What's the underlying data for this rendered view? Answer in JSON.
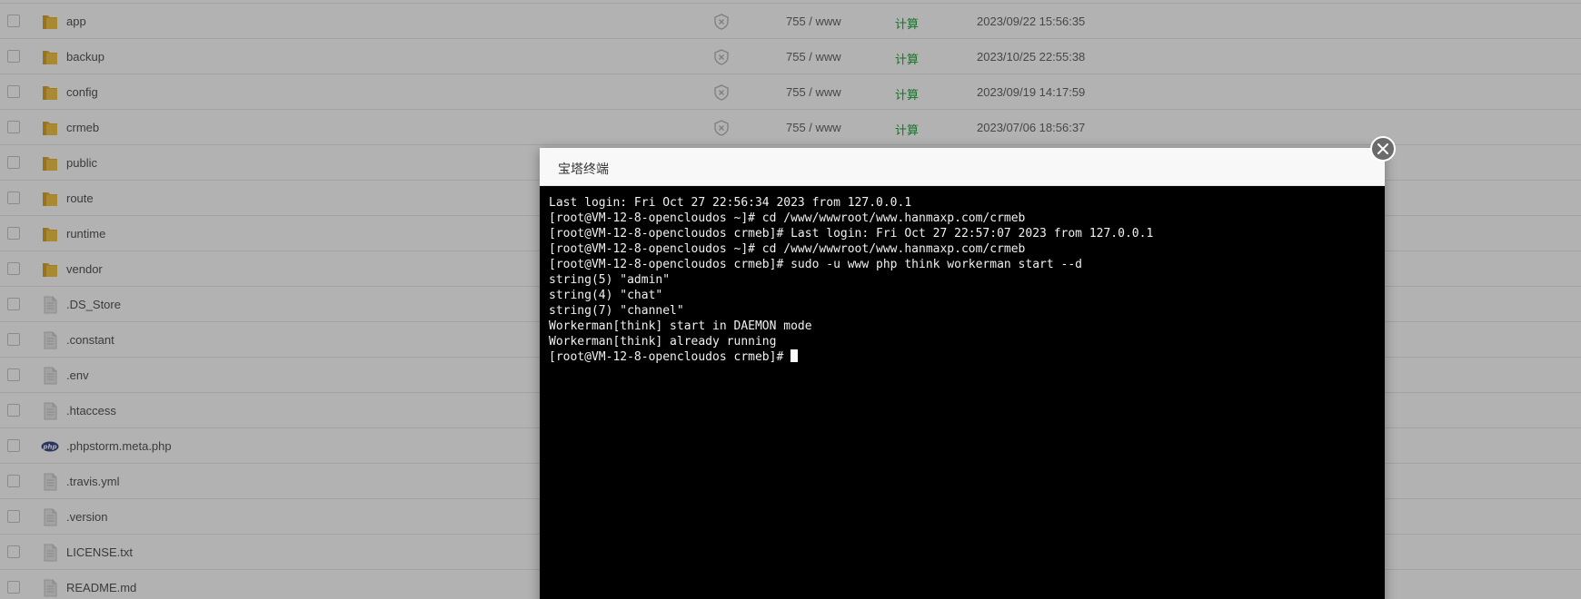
{
  "files": [
    {
      "name": "app",
      "type": "folder",
      "perm": "755 / www",
      "size_action": "计算",
      "mtime": "2023/09/22 15:56:35"
    },
    {
      "name": "backup",
      "type": "folder",
      "perm": "755 / www",
      "size_action": "计算",
      "mtime": "2023/10/25 22:55:38"
    },
    {
      "name": "config",
      "type": "folder",
      "perm": "755 / www",
      "size_action": "计算",
      "mtime": "2023/09/19 14:17:59"
    },
    {
      "name": "crmeb",
      "type": "folder",
      "perm": "755 / www",
      "size_action": "计算",
      "mtime": "2023/07/06 18:56:37"
    },
    {
      "name": "public",
      "type": "folder"
    },
    {
      "name": "route",
      "type": "folder"
    },
    {
      "name": "runtime",
      "type": "folder"
    },
    {
      "name": "vendor",
      "type": "folder"
    },
    {
      "name": ".DS_Store",
      "type": "file"
    },
    {
      "name": ".constant",
      "type": "file"
    },
    {
      "name": ".env",
      "type": "file"
    },
    {
      "name": ".htaccess",
      "type": "file"
    },
    {
      "name": ".phpstorm.meta.php",
      "type": "php"
    },
    {
      "name": ".travis.yml",
      "type": "file"
    },
    {
      "name": ".version",
      "type": "file"
    },
    {
      "name": "LICENSE.txt",
      "type": "file"
    },
    {
      "name": "README.md",
      "type": "file"
    }
  ],
  "dialog": {
    "title": "宝塔终端",
    "close_icon": "close-icon"
  },
  "terminal": {
    "lines": [
      "Last login: Fri Oct 27 22:56:34 2023 from 127.0.0.1",
      "[root@VM-12-8-opencloudos ~]# cd /www/wwwroot/www.hanmaxp.com/crmeb",
      "[root@VM-12-8-opencloudos crmeb]# Last login: Fri Oct 27 22:57:07 2023 from 127.0.0.1",
      "[root@VM-12-8-opencloudos ~]# cd /www/wwwroot/www.hanmaxp.com/crmeb",
      "[root@VM-12-8-opencloudos crmeb]# sudo -u www php think workerman start --d",
      "string(5) \"admin\"",
      "string(4) \"chat\"",
      "string(7) \"channel\"",
      "Workerman[think] start in DAEMON mode",
      "Workerman[think] already running",
      "[root@VM-12-8-opencloudos crmeb]# "
    ]
  },
  "colors": {
    "folder": "#f4c54a",
    "calc_link": "#20a53a",
    "terminal_bg": "#000000",
    "terminal_fg": "#f0f0f0"
  }
}
